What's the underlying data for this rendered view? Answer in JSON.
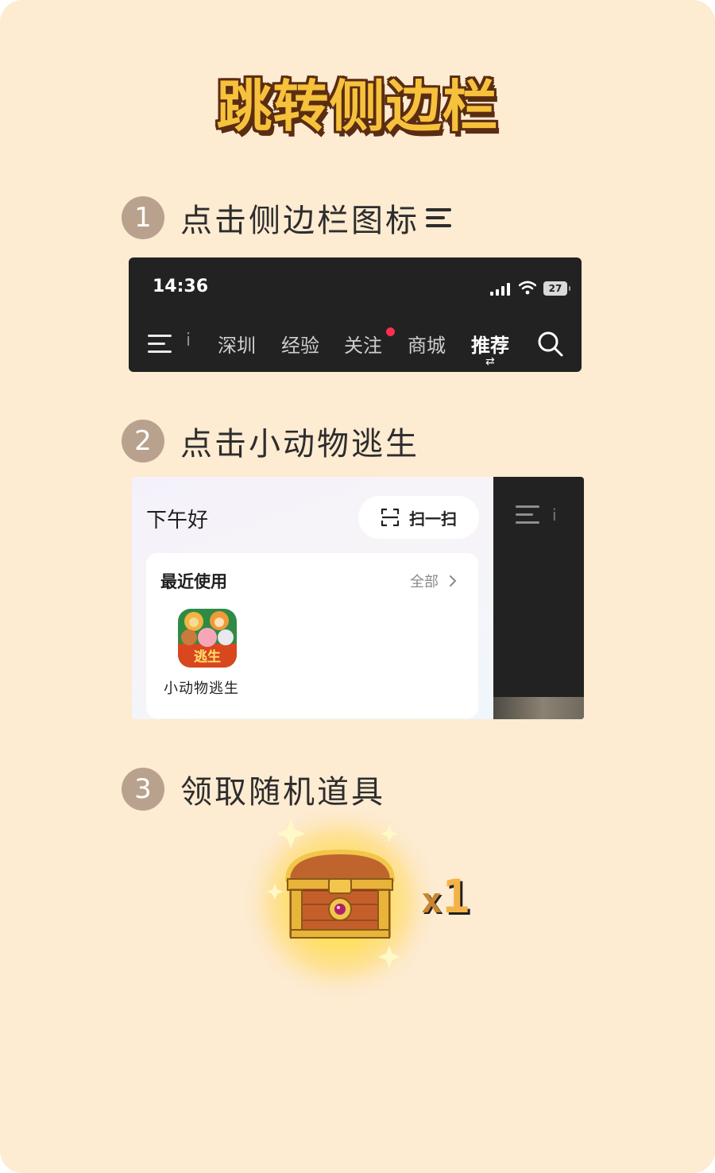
{
  "title": "跳转侧边栏",
  "steps": [
    {
      "number": "1",
      "text": "点击侧边栏图标"
    },
    {
      "number": "2",
      "text": "点击小动物逃生"
    },
    {
      "number": "3",
      "text": "领取随机道具"
    }
  ],
  "screenshot1": {
    "time": "14:36",
    "battery": "27",
    "nav_fragment": "i",
    "tabs": [
      "深圳",
      "经验",
      "关注",
      "商城",
      "推荐"
    ],
    "active_tab": "推荐"
  },
  "screenshot2": {
    "greeting": "下午好",
    "scan_label": "扫一扫",
    "recent_title": "最近使用",
    "all_label": "全部",
    "app_name": "小动物逃生",
    "app_icon_text": "逃生",
    "dark_fragment": "i"
  },
  "reward": {
    "prefix": "x",
    "count": "1"
  },
  "colors": {
    "background": "#fdebd2",
    "step_circle": "#b9a28d",
    "title_fill": "#f7c23b",
    "title_outline": "#5a2d12",
    "dark_ui": "#222222",
    "notification_dot": "#ff2d4f"
  }
}
